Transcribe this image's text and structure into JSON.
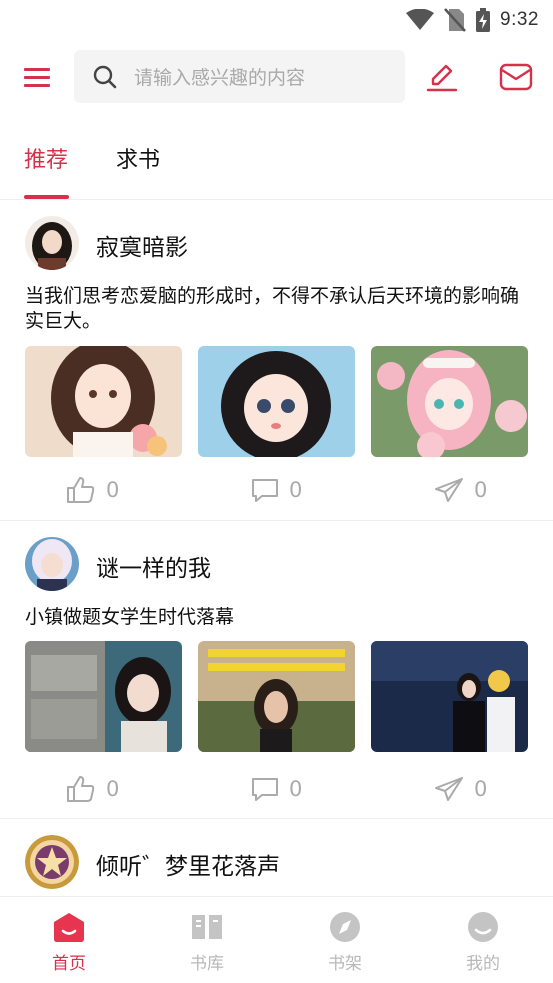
{
  "status_bar": {
    "time": "9:32",
    "icons": [
      "wifi-icon",
      "no-sim-icon",
      "battery-charging-icon"
    ]
  },
  "header": {
    "search_placeholder": "请输入感兴趣的内容",
    "accent_color": "#d6314a",
    "icons": [
      "menu-icon",
      "search-icon",
      "edit-icon",
      "mail-icon"
    ]
  },
  "tabs": [
    {
      "label": "推荐",
      "active": true
    },
    {
      "label": "求书",
      "active": false
    }
  ],
  "posts": [
    {
      "author": "寂寞暗影",
      "text": "当我们思考恋爱脑的形成时，不得不承认后天环境的影响确实巨大。",
      "image_count": 3,
      "likes": "0",
      "comments": "0",
      "shares": "0"
    },
    {
      "author": "谜一样的我",
      "text": "小镇做题女学生时代落幕",
      "image_count": 3,
      "likes": "0",
      "comments": "0",
      "shares": "0"
    },
    {
      "author": "倾听゛梦里花落声"
    }
  ],
  "bottom_nav": [
    {
      "label": "首页",
      "icon": "home-icon",
      "active": true
    },
    {
      "label": "书库",
      "icon": "library-book-icon",
      "active": false
    },
    {
      "label": "书架",
      "icon": "compass-icon",
      "active": false
    },
    {
      "label": "我的",
      "icon": "profile-icon",
      "active": false
    }
  ]
}
